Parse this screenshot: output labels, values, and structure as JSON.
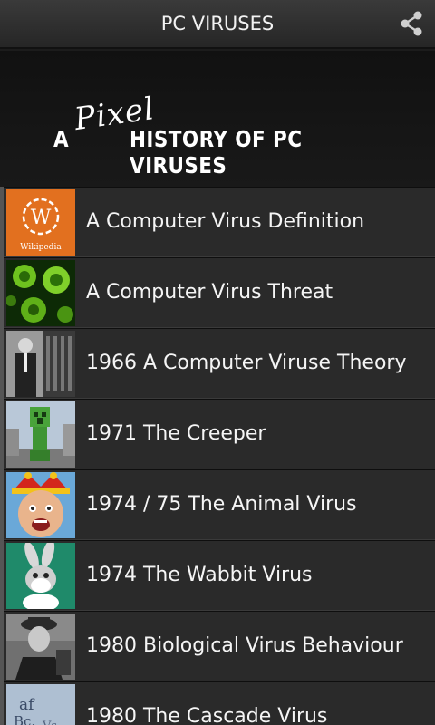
{
  "app": {
    "title": "PC VIRUSES",
    "share_icon": "share-icon"
  },
  "banner": {
    "word_a": "A",
    "word_pixel": "Pixel",
    "word_rest": "HISTORY OF PC VIRUSES"
  },
  "items": [
    {
      "label": "A Computer Virus Definition",
      "thumb": "wikipedia-logo",
      "thumb_text": "Wikipedia"
    },
    {
      "label": "A Computer Virus Threat",
      "thumb": "green-virus-image"
    },
    {
      "label": "1966 A Computer Viruse Theory",
      "thumb": "scientist-photo"
    },
    {
      "label": "1971 The Creeper",
      "thumb": "creeper-image"
    },
    {
      "label": "1974 / 75 The Animal Virus",
      "thumb": "jester-face-image"
    },
    {
      "label": "1974 The Wabbit Virus",
      "thumb": "bugs-bunny-image"
    },
    {
      "label": "1980 Biological Virus Behaviour",
      "thumb": "man-portrait-photo"
    },
    {
      "label": "1980 The Cascade Virus",
      "thumb": "cascade-letters-image"
    }
  ]
}
